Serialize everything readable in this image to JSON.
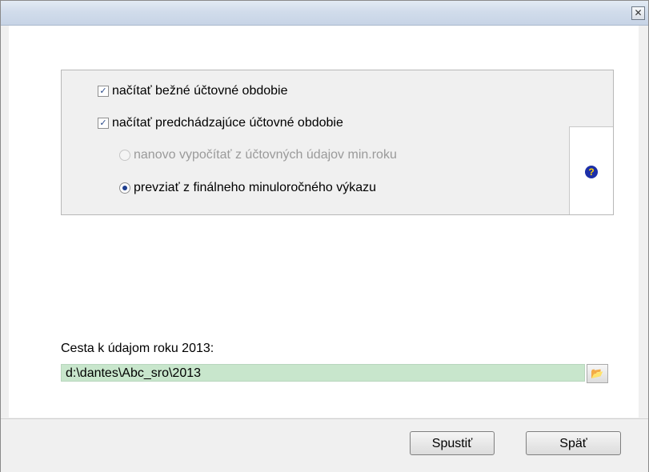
{
  "window": {
    "close_glyph": "✕"
  },
  "options": {
    "current_period": {
      "label": "načítať bežné účtovné obdobie",
      "checked": true
    },
    "previous_period": {
      "label": "načítať predchádzajúce účtovné obdobie",
      "checked": true
    },
    "recalculate": {
      "label": "nanovo vypočítať z účtovných údajov min.roku",
      "selected": false,
      "enabled": false
    },
    "take_final": {
      "label": "prevziať z finálneho minuloročného výkazu",
      "selected": true,
      "enabled": true
    }
  },
  "help": {
    "icon": "question-icon",
    "glyph": "?"
  },
  "path": {
    "label": "Cesta k údajom roku 2013:",
    "value": "d:\\dantes\\Abc_sro\\2013",
    "browse_icon": "folder-open-icon"
  },
  "footer": {
    "run_label": "Spustiť",
    "back_label": "Späť"
  },
  "colors": {
    "path_field": "#c8e6cc",
    "help_icon_bg": "#1c2fa8",
    "help_icon_fg": "#ffd400"
  }
}
